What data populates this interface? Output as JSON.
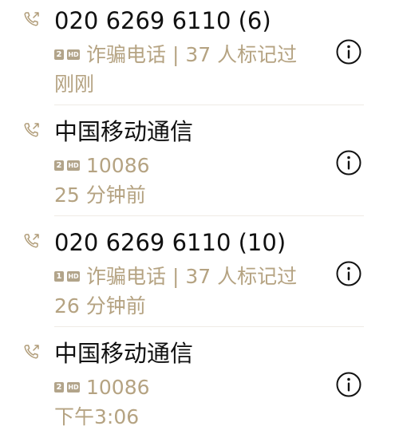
{
  "calls": [
    {
      "title": "020 6269 6110 (6)",
      "sim": "2",
      "hd": "HD",
      "detail": "诈骗电话 | 37 人标记过",
      "time": "刚刚",
      "icon": "outgoing-call-icon"
    },
    {
      "title": "中国移动通信",
      "sim": "2",
      "hd": "HD",
      "detail": "10086",
      "time": "25 分钟前",
      "icon": "outgoing-call-icon"
    },
    {
      "title": "020 6269 6110 (10)",
      "sim": "1",
      "hd": "HD",
      "detail": "诈骗电话 | 37 人标记过",
      "time": "26 分钟前",
      "icon": "outgoing-call-icon"
    },
    {
      "title": "中国移动通信",
      "sim": "2",
      "hd": "HD",
      "detail": "10086",
      "time": "下午3:06",
      "icon": "outgoing-call-icon"
    }
  ],
  "colors": {
    "title": "#111111",
    "secondary": "#b5a382",
    "badge": "#b2a48a",
    "icon": "#b09c78",
    "divider": "#efebe5"
  }
}
